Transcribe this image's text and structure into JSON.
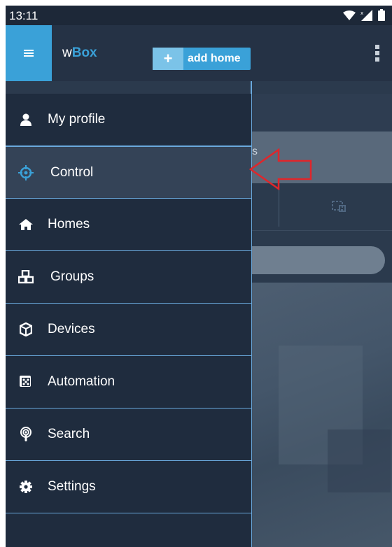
{
  "status_bar": {
    "time": "13:11"
  },
  "app_bar": {
    "logo_prefix": "w",
    "logo_accent": "Box",
    "add_home_label": "add home",
    "add_home_plus": "+"
  },
  "drawer": {
    "items": [
      {
        "label": "My profile",
        "icon": "person-icon"
      },
      {
        "label": "Control",
        "icon": "crosshair-icon",
        "active": true
      },
      {
        "label": "Homes",
        "icon": "home-icon"
      },
      {
        "label": "Groups",
        "icon": "cubes-icon"
      },
      {
        "label": "Devices",
        "icon": "cube-icon"
      },
      {
        "label": "Automation",
        "icon": "dice-icon"
      },
      {
        "label": "Search",
        "icon": "podcast-icon"
      },
      {
        "label": "Settings",
        "icon": "gear-icon"
      }
    ]
  },
  "background": {
    "banner_fragment": "s"
  },
  "colors": {
    "accent": "#3aa1d8",
    "drawer_bg": "#1f2c3e",
    "active_bg": "#344357",
    "divider": "#6aa9dd",
    "annotation_arrow": "#e0262b"
  }
}
